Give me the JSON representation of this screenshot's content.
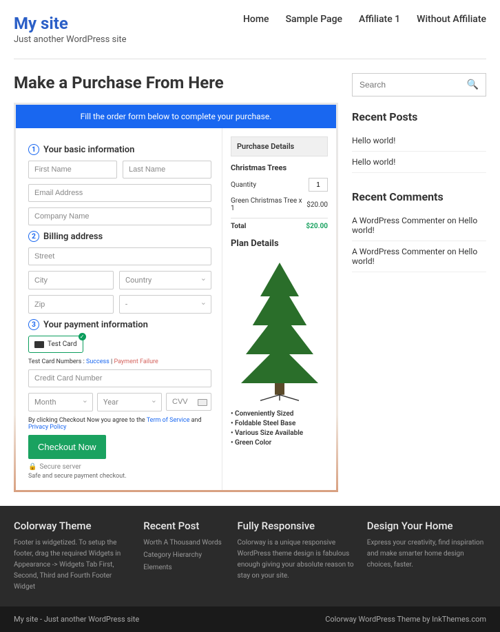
{
  "site": {
    "title": "My site",
    "tagline": "Just another WordPress site"
  },
  "nav": [
    {
      "label": "Home"
    },
    {
      "label": "Sample Page"
    },
    {
      "label": "Affiliate 1"
    },
    {
      "label": "Without Affiliate"
    }
  ],
  "page_title": "Make a Purchase From Here",
  "order_bar": "Fill the order form below to complete your purchase.",
  "sections": {
    "basic": "Your basic information",
    "billing": "Billing address",
    "payment": "Your payment information"
  },
  "placeholders": {
    "first": "First Name",
    "last": "Last Name",
    "email": "Email Address",
    "company": "Company Name",
    "street": "Street",
    "city": "City",
    "country": "Country",
    "zip": "Zip",
    "dash": "-",
    "cc": "Credit Card Number",
    "month": "Month",
    "year": "Year",
    "cvv": "CVV"
  },
  "card_box": "Test Card",
  "test_line": {
    "pre": "Test Card Numbers : ",
    "success": "Success",
    "sep": " | ",
    "fail": "Payment Failure"
  },
  "agree": {
    "pre": "By clicking Checkout Now you agree to the ",
    "tos": "Term of Service",
    "and": " and ",
    "pp": "Privacy Policy"
  },
  "checkout": "Checkout Now",
  "secure": "Secure server",
  "secure_note": "Safe and secure payment checkout.",
  "details": {
    "head": "Purchase Details",
    "product": "Christmas Trees",
    "qty_label": "Quantity",
    "qty": "1",
    "line": "Green Christmas Tree x 1",
    "line_price": "$20.00",
    "total_label": "Total",
    "total": "$20.00"
  },
  "plan_title": "Plan Details",
  "features": [
    "Conveniently Sized",
    "Foldable Steel Base",
    "Various Size Available",
    "Green Color"
  ],
  "search_placeholder": "Search",
  "recent_posts": {
    "title": "Recent Posts",
    "items": [
      "Hello world!",
      "Hello world!"
    ]
  },
  "recent_comments": {
    "title": "Recent Comments",
    "items": [
      {
        "who": "A WordPress Commenter",
        "on": "on",
        "post": "Hello world!"
      },
      {
        "who": "A WordPress Commenter",
        "on": "on",
        "post": "Hello world!"
      }
    ]
  },
  "footer_widgets": [
    {
      "title": "Colorway Theme",
      "text": "Footer is widgetized. To setup the footer, drag the required Widgets in Appearance -> Widgets Tab First, Second, Third and Fourth Footer Widget"
    },
    {
      "title": "Recent Post",
      "lines": [
        "Worth A Thousand Words",
        "Category Hierarchy",
        "Elements"
      ]
    },
    {
      "title": "Fully Responsive",
      "text": "Colorway is a unique responsive WordPress theme design is fabulous enough giving your absolute reason to stay on your site."
    },
    {
      "title": "Design Your Home",
      "text": "Express your creativity, find inspiration and make smarter home design choices, faster."
    }
  ],
  "footer_bar": {
    "left": "My site - Just another WordPress site",
    "right": "Colorway WordPress Theme by InkThemes.com"
  }
}
